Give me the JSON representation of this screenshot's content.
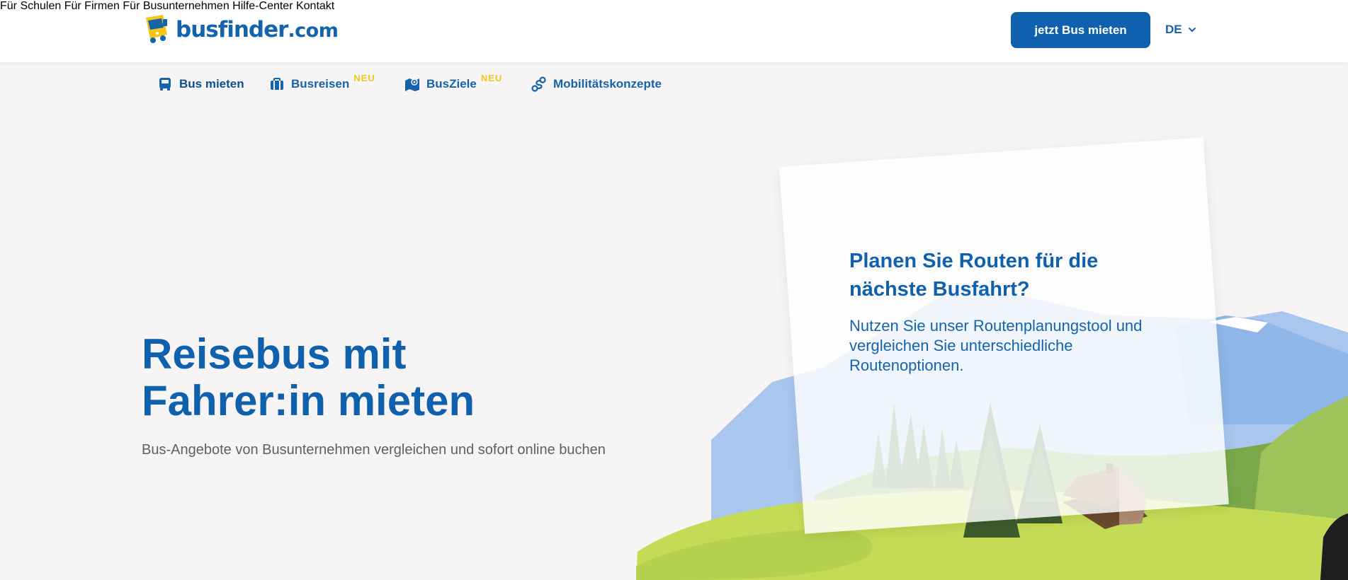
{
  "brand": {
    "name": "busfinder",
    "tld": ".com"
  },
  "mainnav": [
    {
      "label": "Für Schulen"
    },
    {
      "label": "Für Firmen"
    },
    {
      "label": "Für Busunternehmen"
    },
    {
      "label": "Hilfe-Center"
    },
    {
      "label": "Kontakt"
    }
  ],
  "cta": {
    "label": "jetzt Bus mieten"
  },
  "language": {
    "label": "DE"
  },
  "subnav": [
    {
      "label": "Bus mieten",
      "icon": "bus-icon",
      "active": true
    },
    {
      "label": "Busreisen",
      "icon": "suitcase-icon",
      "badge": "NEU"
    },
    {
      "label": "BusZiele",
      "icon": "map-icon",
      "badge": "NEU"
    },
    {
      "label": "Mobilitätskonzepte",
      "icon": "route-icon"
    }
  ],
  "hero": {
    "title_line1": "Reisebus mit",
    "title_line2": "Fahrer:in mieten",
    "subtitle": "Bus-Angebote von Busunternehmen vergleichen und sofort online buchen"
  },
  "promo": {
    "title": "Planen Sie Routen für die nächste Busfahrt?",
    "text": "Nutzen Sie unser Routenplanungstool und vergleichen Sie unterschiedliche Routenoptionen."
  },
  "colors": {
    "brand_blue": "#1061ad",
    "accent_yellow": "#f2c81b",
    "grass": "#b9d34a",
    "background": "#f6f4f4"
  }
}
